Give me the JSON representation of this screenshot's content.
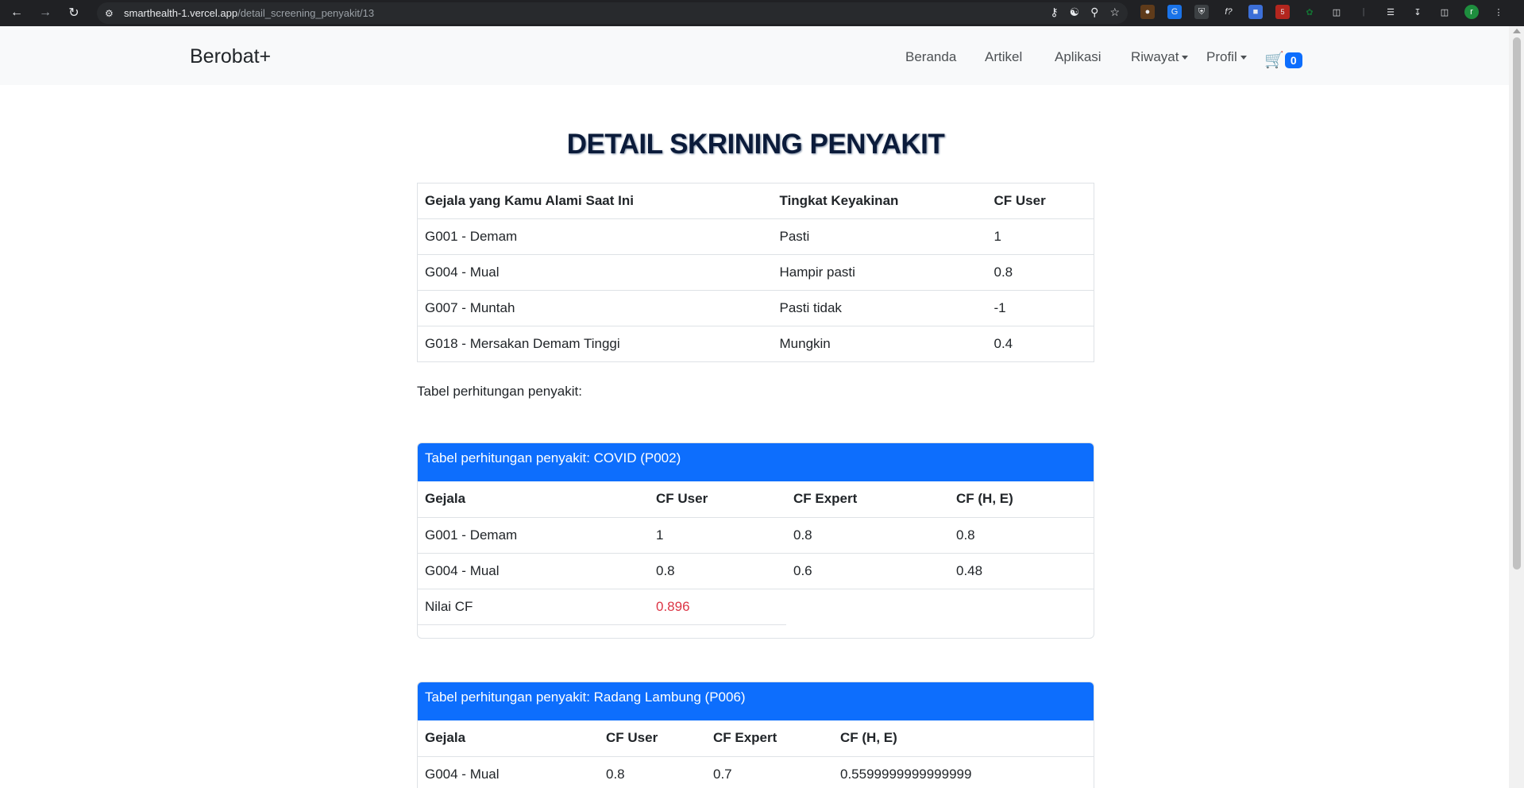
{
  "browser": {
    "url_host": "smarthealth-1.vercel.app",
    "url_path": "/detail_screening_penyakit/13",
    "extension_badge": "5",
    "profile_initial": "r"
  },
  "navbar": {
    "brand": "Berobat+",
    "links": [
      "Beranda",
      "Artikel",
      "Aplikasi",
      "Riwayat",
      "Profil"
    ],
    "cart_count": "0"
  },
  "page": {
    "title": "DETAIL SKRINING PENYAKIT",
    "subtitle": "Tabel perhitungan penyakit:"
  },
  "symptoms_table": {
    "headers": [
      "Gejala yang Kamu Alami Saat Ini",
      "Tingkat Keyakinan",
      "CF User"
    ],
    "rows": [
      [
        "G001 - Demam",
        "Pasti",
        "1"
      ],
      [
        "G004 - Mual",
        "Hampir pasti",
        "0.8"
      ],
      [
        "G007 - Muntah",
        "Pasti tidak",
        "-1"
      ],
      [
        "G018 - Mersakan Demam Tinggi",
        "Mungkin",
        "0.4"
      ]
    ]
  },
  "disease_cards": [
    {
      "title": "Tabel perhitungan penyakit: COVID (P002)",
      "headers": [
        "Gejala",
        "CF User",
        "CF Expert",
        "CF (H, E)"
      ],
      "rows": [
        [
          "G001 - Demam",
          "1",
          "0.8",
          "0.8"
        ],
        [
          "G004 - Mual",
          "0.8",
          "0.6",
          "0.48"
        ]
      ],
      "cf_label": "Nilai CF",
      "cf_value": "0.896"
    },
    {
      "title": "Tabel perhitungan penyakit: Radang Lambung (P006)",
      "headers": [
        "Gejala",
        "CF User",
        "CF Expert",
        "CF (H, E)"
      ],
      "rows": [
        [
          "G004 - Mual",
          "0.8",
          "0.7",
          "0.5599999999999999"
        ]
      ]
    }
  ],
  "colors": {
    "primary": "#0d6efd",
    "danger": "#dc3545",
    "navbar_bg": "#f8f9fa",
    "chrome_bg": "#202124"
  }
}
